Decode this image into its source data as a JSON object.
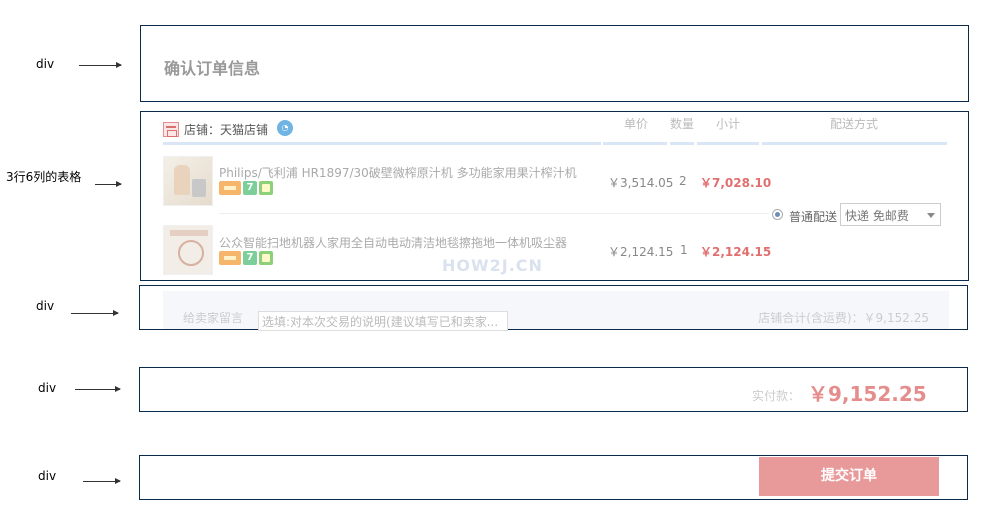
{
  "annotations": {
    "div1": "div",
    "table": "3行6列的表格",
    "div2": "div",
    "div3": "div",
    "div4": "div"
  },
  "order_title": "确认订单信息",
  "shop": {
    "label": "店铺：天猫店铺"
  },
  "columns": [
    "单价",
    "数量",
    "小计",
    "配送方式"
  ],
  "products": [
    {
      "name": "Philips/飞利浦 HR1897/30破壁微榨原汁机 多功能家用果汁榨汁机",
      "price": "￥3,514.05",
      "qty": "2",
      "subtotal": "￥7,028.10"
    },
    {
      "name": "公众智能扫地机器人家用全自动电动清洁地毯擦拖地一体机吸尘器",
      "price": "￥2,124.15",
      "qty": "1",
      "subtotal": "￥2,124.15"
    }
  ],
  "shipping": {
    "option_label": "普通配送",
    "select_value": "快递 免邮费"
  },
  "watermark": "HOW2J.CN",
  "message": {
    "label": "给卖家留言",
    "placeholder": "选填:对本次交易的说明(建议填写已和卖家...",
    "shop_total": "店铺合计(含运费)：￥9,152.25"
  },
  "payment": {
    "label": "实付款：",
    "value": "￥9,152.25"
  },
  "submit_label": "提交订单",
  "colors": {
    "accent_red": "#e26f6f",
    "button": "#e89a9a",
    "border": "#0b2a4a"
  }
}
